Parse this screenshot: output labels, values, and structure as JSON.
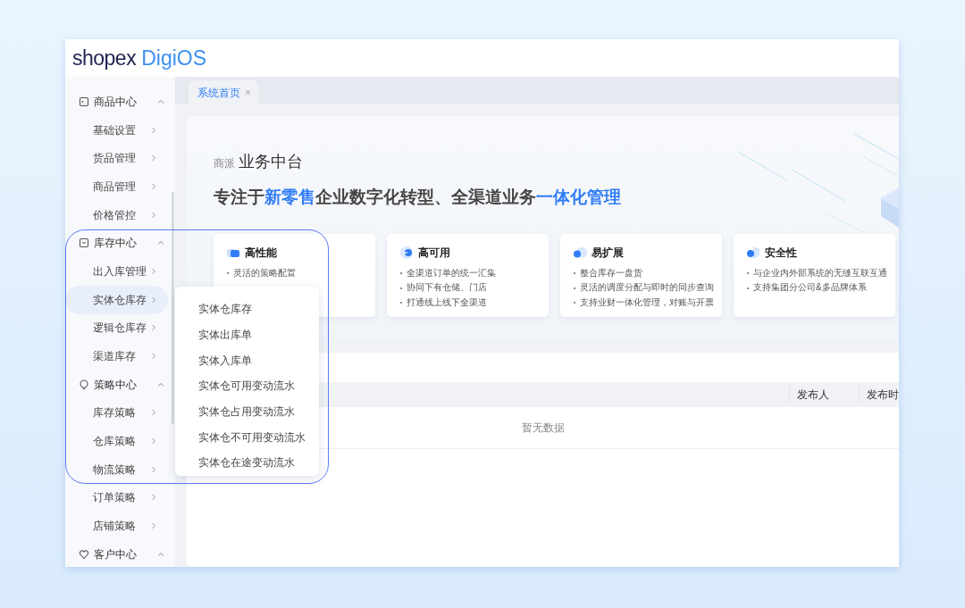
{
  "logo": {
    "brand": "shopex",
    "product": "DigiOS"
  },
  "sidebar": {
    "groups": [
      {
        "label": "商品中心",
        "kind": "goods",
        "expanded": true,
        "children": [
          {
            "label": "基础设置",
            "selected": false
          },
          {
            "label": "货品管理",
            "selected": false
          },
          {
            "label": "商品管理",
            "selected": false
          },
          {
            "label": "价格管控",
            "selected": false
          }
        ]
      },
      {
        "label": "库存中心",
        "kind": "stock",
        "expanded": true,
        "children": [
          {
            "label": "出入库管理",
            "selected": false
          },
          {
            "label": "实体仓库存",
            "selected": true
          },
          {
            "label": "逻辑仓库存",
            "selected": false
          },
          {
            "label": "渠道库存",
            "selected": false
          }
        ]
      },
      {
        "label": "策略中心",
        "kind": "strategy",
        "expanded": true,
        "children": [
          {
            "label": "库存策略",
            "selected": false
          },
          {
            "label": "仓库策略",
            "selected": false
          },
          {
            "label": "物流策略",
            "selected": false
          },
          {
            "label": "订单策略",
            "selected": false
          },
          {
            "label": "店铺策略",
            "selected": false
          }
        ]
      },
      {
        "label": "客户中心",
        "kind": "customer",
        "expanded": true
      }
    ]
  },
  "tabs": [
    {
      "label": "系统首页",
      "selected": true,
      "close": "×"
    }
  ],
  "hero": {
    "brand": "商派",
    "title": "业务中台",
    "headline": [
      {
        "text": "专注于",
        "highlight": false
      },
      {
        "text": "新零售",
        "highlight": true
      },
      {
        "text": "企业数字化转型、全渠道业务",
        "highlight": false
      },
      {
        "text": "一体化管理",
        "highlight": true
      }
    ],
    "features": [
      {
        "title": "高性能",
        "kind": "performance",
        "points": [
          "灵活的策略配置"
        ]
      },
      {
        "title": "高可用",
        "kind": "availability",
        "points": [
          "全渠道订单的统一汇集",
          "协同下有仓储、门店",
          "打通线上线下全渠道"
        ]
      },
      {
        "title": "易扩展",
        "kind": "scalability",
        "points": [
          "整合库存一盘货",
          "灵活的调度分配与即时的同步查询",
          "支持业财一体化管理，对账与开票"
        ]
      },
      {
        "title": "安全性",
        "kind": "security",
        "points": [
          "与企业内外部系统的无缝互联互通",
          "支持集团分公司&多品牌体系"
        ]
      }
    ]
  },
  "table": {
    "columns": [
      "发布人",
      "发布时"
    ],
    "empty_text": "暂无数据"
  },
  "popup_menu": {
    "items": [
      "实体仓库存",
      "实体出库单",
      "实体入库单",
      "实体仓可用变动流水",
      "实体仓占用变动流水",
      "实体仓不可用变动流水",
      "实体仓在途变动流水"
    ]
  }
}
